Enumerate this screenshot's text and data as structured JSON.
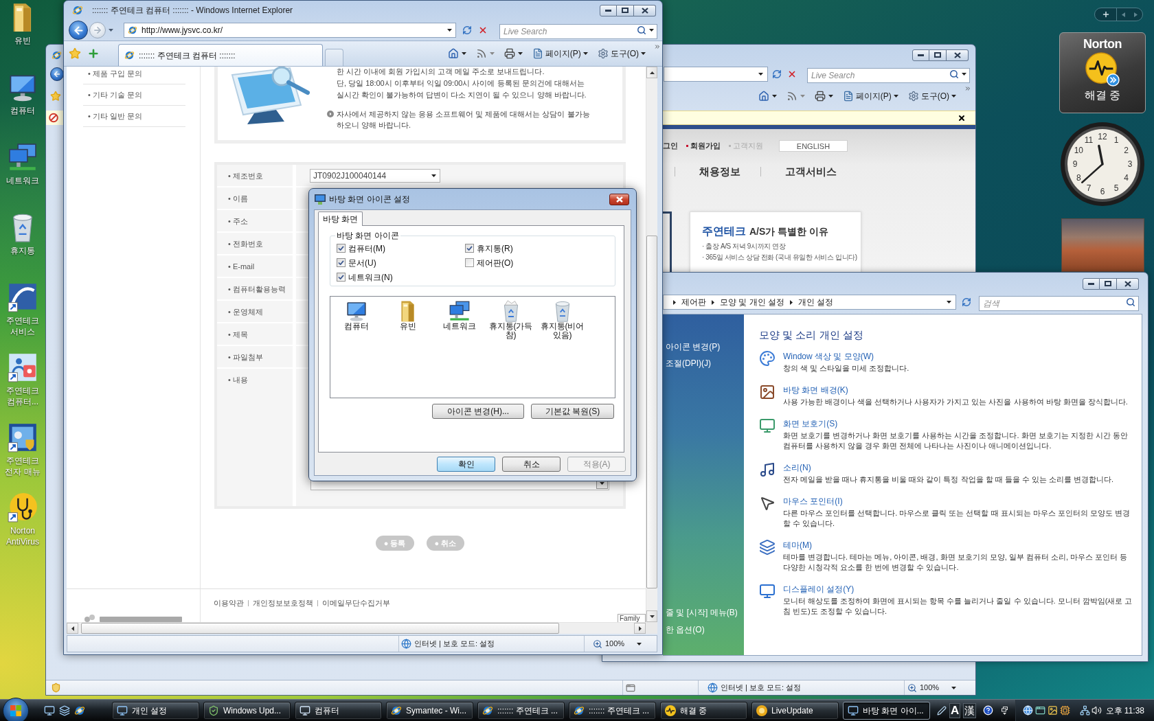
{
  "desktop": {
    "icons": [
      {
        "label": "유빈",
        "kind": "folder"
      },
      {
        "label": "컴퓨터",
        "kind": "computer"
      },
      {
        "label": "네트워크",
        "kind": "network"
      },
      {
        "label": "휴지통",
        "kind": "recycle"
      },
      {
        "label": "주연테크 서비스",
        "kind": "service"
      },
      {
        "label": "주연테크 컴퓨터...",
        "kind": "support"
      },
      {
        "label": "주연테크 전자 매뉴",
        "kind": "manual"
      },
      {
        "label": "Norton AntiVirus",
        "kind": "norton"
      }
    ]
  },
  "back_browser": {
    "search": {
      "placeholder": "Live Search"
    },
    "toolbar": {
      "page_menu": "페이지(P)",
      "tools_menu": "도구(O)"
    },
    "header_links": [
      {
        "label": "그인",
        "dimmed": false
      },
      {
        "label": "회원가입",
        "color": "#c8102e",
        "dimmed": false
      },
      {
        "label": "고객지원",
        "color": "#b5b5b5",
        "dimmed": true
      }
    ],
    "english_button": "ENGLISH",
    "nav": [
      "채용정보",
      "고객서비스"
    ],
    "promo": {
      "brand": "주연테크",
      "title": "A/S가 특별한 이유",
      "lines": [
        "· 출장 A/S 저녁 9시까지 연장",
        "· 365일 서비스 상담 전화 (국내 유일한 서비스 입니다)"
      ]
    },
    "status": {
      "zone": "인터넷 | 보호 모드: 설정",
      "zoom": "100%"
    }
  },
  "browser": {
    "title": "::::::: 주연테크 컴퓨터 ::::::: - Windows Internet Explorer",
    "address": "http://www.jysvc.co.kr/",
    "search": {
      "placeholder": "Live Search"
    },
    "tabs": [
      {
        "label": "::::::: 주연테크 컴퓨터 :::::::",
        "selected": true
      }
    ],
    "toolbar": {
      "page_menu": "페이지(P)",
      "tools_menu": "도구(O)"
    },
    "page": {
      "side_nav": [
        "• 제품 구입 문의",
        "• 기타 기술 문의",
        "• 기타 일반 문의"
      ],
      "notice": {
        "lines": [
          "한 시간 이내에 회원 가입시의 고객 메일 주소로 보내드립니다.",
          "단, 당일 18:00시 이후부터 익일 09:00시 사이에 등록된 문의건에 대해서는",
          "실시간 확인이 불가능하여 답변이 다소 지연이 될 수 있으니 양해 바랍니다."
        ],
        "note_lines": [
          "자사에서 제공하지 않는 응용 소프트웨어 및 제품에 대해서는 상담이 불가능",
          "하오니 양해 바랍니다."
        ]
      },
      "form": {
        "rows": [
          {
            "label": "• 제조번호",
            "kind": "select",
            "value": "JT0902J100040144"
          },
          {
            "label": "• 이름",
            "kind": "text"
          },
          {
            "label": "• 주소",
            "kind": "text"
          },
          {
            "label": "• 전화번호",
            "kind": "text"
          },
          {
            "label": "• E-mail",
            "kind": "text"
          },
          {
            "label": "• 컴퓨터활용능력",
            "kind": "text"
          },
          {
            "label": "• 운영체제",
            "kind": "text"
          },
          {
            "label": "• 제목",
            "kind": "text"
          },
          {
            "label": "• 파일첨부",
            "kind": "text"
          },
          {
            "label": "• 내용",
            "kind": "textarea"
          }
        ]
      },
      "buttons": [
        "● 등록",
        "● 취소"
      ],
      "footer_links": [
        "이용약관",
        "개인정보보호정책",
        "이메일무단수집거부"
      ],
      "family_select": "Family"
    },
    "status": {
      "zone": "인터넷 | 보호 모드: 설정",
      "zoom": "100%"
    }
  },
  "dialog": {
    "title": "바탕 화면 아이콘 설정",
    "tabs": [
      {
        "label": "바탕 화면",
        "selected": true
      }
    ],
    "group": {
      "legend": "바탕 화면 아이콘",
      "checkboxes": [
        {
          "label": "컴퓨터(M)",
          "checked": true
        },
        {
          "label": "휴지통(R)",
          "checked": true
        },
        {
          "label": "문서(U)",
          "checked": true
        },
        {
          "label": "제어판(O)",
          "checked": false
        },
        {
          "label": "네트워크(N)",
          "checked": true
        }
      ]
    },
    "icons": [
      {
        "label": "컴퓨터",
        "kind": "computer"
      },
      {
        "label": "유빈",
        "kind": "folder"
      },
      {
        "label": "네트워크",
        "kind": "network"
      },
      {
        "label": "휴지통(가득 참)",
        "kind": "recycle_full"
      },
      {
        "label": "휴지통(비어 있음)",
        "kind": "recycle"
      }
    ],
    "icon_buttons": [
      "아이콘 변경(H)...",
      "기본값 복원(S)"
    ],
    "buttons": [
      {
        "label": "확인",
        "default": true,
        "disabled": false
      },
      {
        "label": "취소",
        "default": false,
        "disabled": false
      },
      {
        "label": "적용(A)",
        "default": false,
        "disabled": true
      }
    ]
  },
  "control_panel": {
    "breadcrumb": [
      "제어판",
      "모양 및 개인 설정",
      "개인 설정"
    ],
    "search": {
      "placeholder": "검색"
    },
    "tasks": [
      "아이콘 변경(P)",
      "조절(DPI)(J)"
    ],
    "see_also": [
      "줄 및 [시작] 메뉴(B)",
      "한 옵션(O)"
    ],
    "heading": "모양 및 소리 개인 설정",
    "items": [
      {
        "kind": "colors",
        "title": "Window 색상 및 모양(W)",
        "description": "창의 색 및 스타일을 미세 조정합니다."
      },
      {
        "kind": "background",
        "title": "바탕 화면 배경(K)",
        "description": "사용 가능한 배경이나 색을 선택하거나 사용자가 가지고 있는 사진을 사용하여 바탕 화면을 장식합니다."
      },
      {
        "kind": "screensaver",
        "title": "화면 보호기(S)",
        "description": "화면 보호기를 변경하거나 화면 보호기를 사용하는 시간을 조정합니다. 화면 보호기는 지정한 시간 동안 컴퓨터를 사용하지 않을 경우 화면 전체에 나타나는 사진이나 애니메이션입니다."
      },
      {
        "kind": "sounds",
        "title": "소리(N)",
        "description": "전자 메일을 받을 때나 휴지통을 비울 때와 같이 특정 작업을 할 때 들을 수 있는 소리를 변경합니다."
      },
      {
        "kind": "mouse",
        "title": "마우스 포인터(I)",
        "description": "다른 마우스 포인터를 선택합니다. 마우스로 클릭 또는 선택할 때 표시되는 마우스 포인터의 모양도 변경할 수 있습니다."
      },
      {
        "kind": "themes",
        "title": "테마(M)",
        "description": "테마를 변경합니다. 테마는 메뉴, 아이콘, 배경, 화면 보호기의 모양, 일부 컴퓨터 소리, 마우스 포인터 등 다양한 시청각적 요소를 한 번에 변경할 수 있습니다."
      },
      {
        "kind": "display",
        "title": "디스플레이 설정(Y)",
        "description": "모니터 해상도를 조정하여 화면에 표시되는 항목 수를 늘리거나 줄일 수 있습니다. 모니터 깜박임(새로 고침 빈도)도 조정할 수 있습니다."
      }
    ]
  },
  "gadgets": {
    "norton": {
      "logo": "Norton",
      "status": "해결 중"
    },
    "clock": {
      "numerals": [
        "11",
        "12",
        "1",
        "10",
        "2",
        "9",
        "3",
        "8",
        "4",
        "7",
        "6",
        "5"
      ]
    }
  },
  "taskbar": {
    "buttons": [
      {
        "label": "개인 설정",
        "kind": "monitor",
        "selected": false
      },
      {
        "label": "Windows Upd...",
        "kind": "update",
        "selected": false
      },
      {
        "label": "컴퓨터",
        "kind": "computer",
        "selected": false
      },
      {
        "label": "Symantec - Wi...",
        "kind": "ie",
        "selected": false
      },
      {
        "label": "::::::: 주연테크 ...",
        "kind": "ie",
        "selected": false
      },
      {
        "label": "::::::: 주연테크 ...",
        "kind": "ie",
        "selected": false
      },
      {
        "label": "해결 중",
        "kind": "norton",
        "selected": false
      },
      {
        "label": "LiveUpdate",
        "kind": "liveupdate",
        "selected": false
      },
      {
        "label": "바탕 화면 아이...",
        "kind": "monitor",
        "selected": true
      }
    ],
    "language": [
      "A",
      "漢"
    ],
    "clock": "오후 11:38"
  }
}
